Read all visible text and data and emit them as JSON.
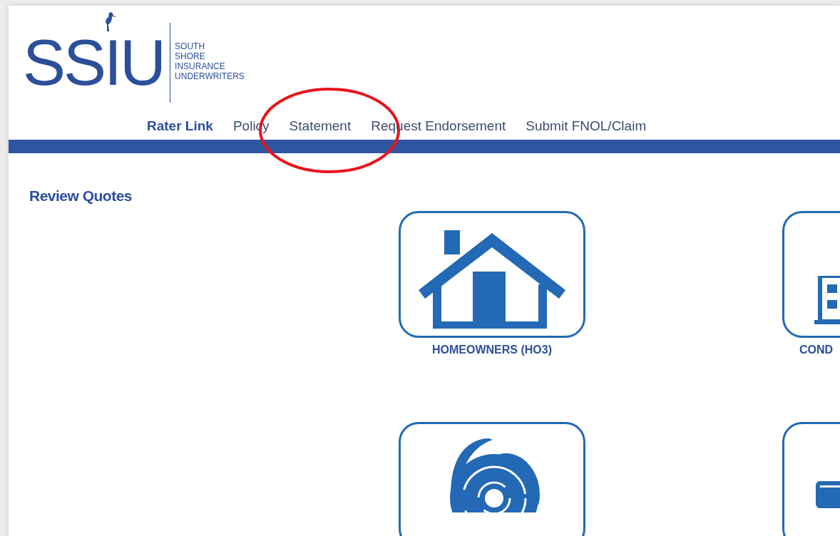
{
  "logo": {
    "mark": "SSIU",
    "lines": [
      "SOUTH",
      "SHORE",
      "INSURANCE",
      "UNDERWRITERS"
    ]
  },
  "nav": [
    {
      "label": "Rater Link",
      "selected": true,
      "circled": false
    },
    {
      "label": "Policy",
      "selected": false,
      "circled": false
    },
    {
      "label": "Statement",
      "selected": false,
      "circled": true
    },
    {
      "label": "Request Endorsement",
      "selected": false,
      "circled": false
    },
    {
      "label": "Submit FNOL/Claim",
      "selected": false,
      "circled": false
    }
  ],
  "section_title": "Review Quotes",
  "tiles": [
    {
      "kind": "house",
      "label": "HOMEOWNERS (HO3)"
    },
    {
      "kind": "building",
      "label": "COND"
    },
    {
      "kind": "hurricane"
    },
    {
      "kind": "form"
    }
  ]
}
